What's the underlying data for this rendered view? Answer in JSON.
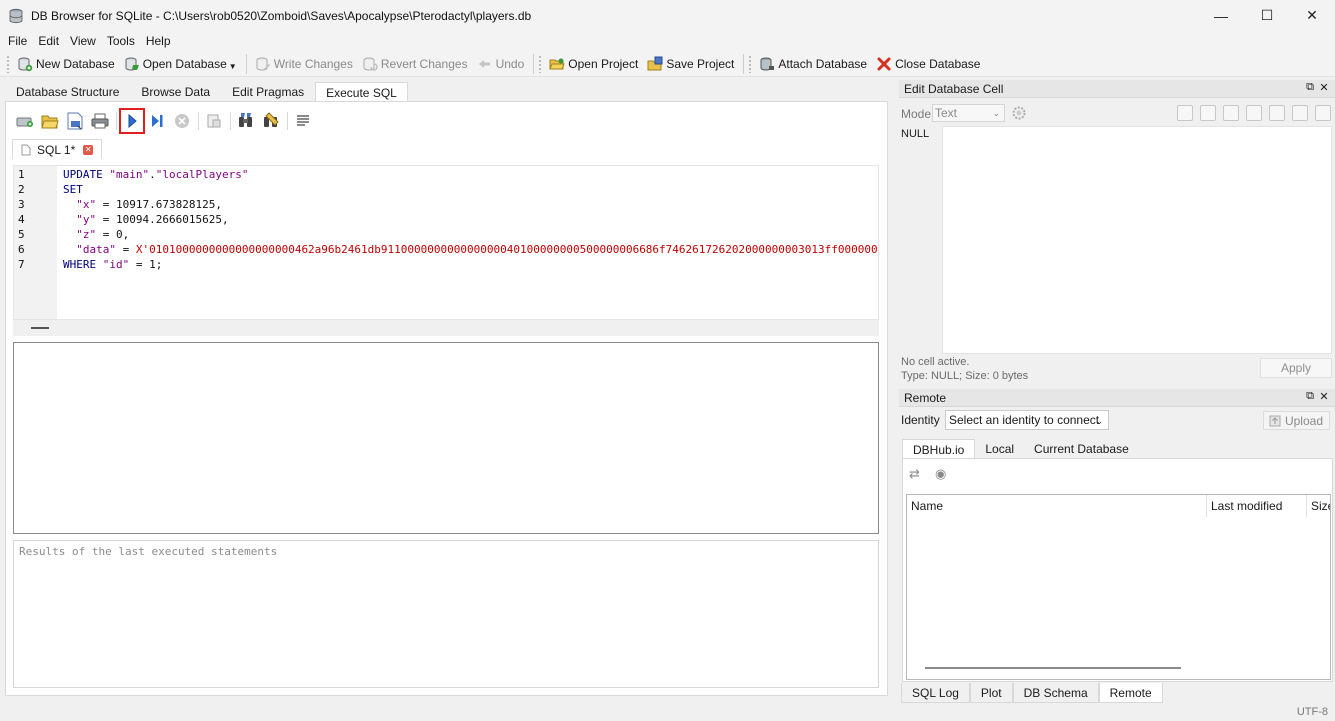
{
  "window": {
    "title": "DB Browser for SQLite - C:\\Users\\rob0520\\Zomboid\\Saves\\Apocalypse\\Pterodactyl\\players.db",
    "minimize": "—",
    "maximize": "☐",
    "close": "✕"
  },
  "menu": [
    "File",
    "Edit",
    "View",
    "Tools",
    "Help"
  ],
  "toolbar": {
    "new_database": "New Database",
    "open_database": "Open Database",
    "write_changes": "Write Changes",
    "revert_changes": "Revert Changes",
    "undo": "Undo",
    "open_project": "Open Project",
    "save_project": "Save Project",
    "attach_database": "Attach Database",
    "close_database": "Close Database"
  },
  "main_tabs": [
    "Database Structure",
    "Browse Data",
    "Edit Pragmas",
    "Execute SQL"
  ],
  "sql_tab": {
    "label": "SQL 1*"
  },
  "sql_lines": [
    {
      "n": "1",
      "parts": [
        [
          "kw",
          "UPDATE "
        ],
        [
          "str",
          "\"main\""
        ],
        [
          "num",
          "."
        ],
        [
          "str",
          "\"localPlayers\""
        ]
      ]
    },
    {
      "n": "2",
      "parts": [
        [
          "kw",
          "SET"
        ]
      ]
    },
    {
      "n": "3",
      "parts": [
        [
          "num",
          "  "
        ],
        [
          "str",
          "\"x\""
        ],
        [
          "num",
          " = 10917.673828125,"
        ]
      ]
    },
    {
      "n": "4",
      "parts": [
        [
          "num",
          "  "
        ],
        [
          "str",
          "\"y\""
        ],
        [
          "num",
          " = 10094.2666015625,"
        ]
      ]
    },
    {
      "n": "5",
      "parts": [
        [
          "num",
          "  "
        ],
        [
          "str",
          "\"z\""
        ],
        [
          "num",
          " = 0,"
        ]
      ]
    },
    {
      "n": "6",
      "parts": [
        [
          "num",
          "  "
        ],
        [
          "str",
          "\"data\""
        ],
        [
          "num",
          " = "
        ],
        [
          "hex",
          "X'0101000000000000000000462a96b2461db911000000000000000040100000000500000006686f746261726202000000003013ff000000"
        ]
      ]
    },
    {
      "n": "7",
      "parts": [
        [
          "kw",
          "WHERE "
        ],
        [
          "str",
          "\"id\""
        ],
        [
          "num",
          " = 1;"
        ]
      ]
    }
  ],
  "results_placeholder": "Results of the last executed statements",
  "edit_cell": {
    "title": "Edit Database Cell",
    "mode_label": "Mode:",
    "mode_value": "Text",
    "null_label": "NULL",
    "no_cell": "No cell active.",
    "type_info": "Type: NULL; Size: 0 bytes",
    "apply": "Apply"
  },
  "remote": {
    "title": "Remote",
    "identity_label": "Identity",
    "identity_value": "Select an identity to connect",
    "upload": "Upload",
    "tabs": [
      "DBHub.io",
      "Local",
      "Current Database"
    ],
    "columns": [
      "Name",
      "Last modified",
      "Size"
    ]
  },
  "bottom_tabs": [
    "SQL Log",
    "Plot",
    "DB Schema",
    "Remote"
  ],
  "status": {
    "encoding": "UTF-8"
  }
}
